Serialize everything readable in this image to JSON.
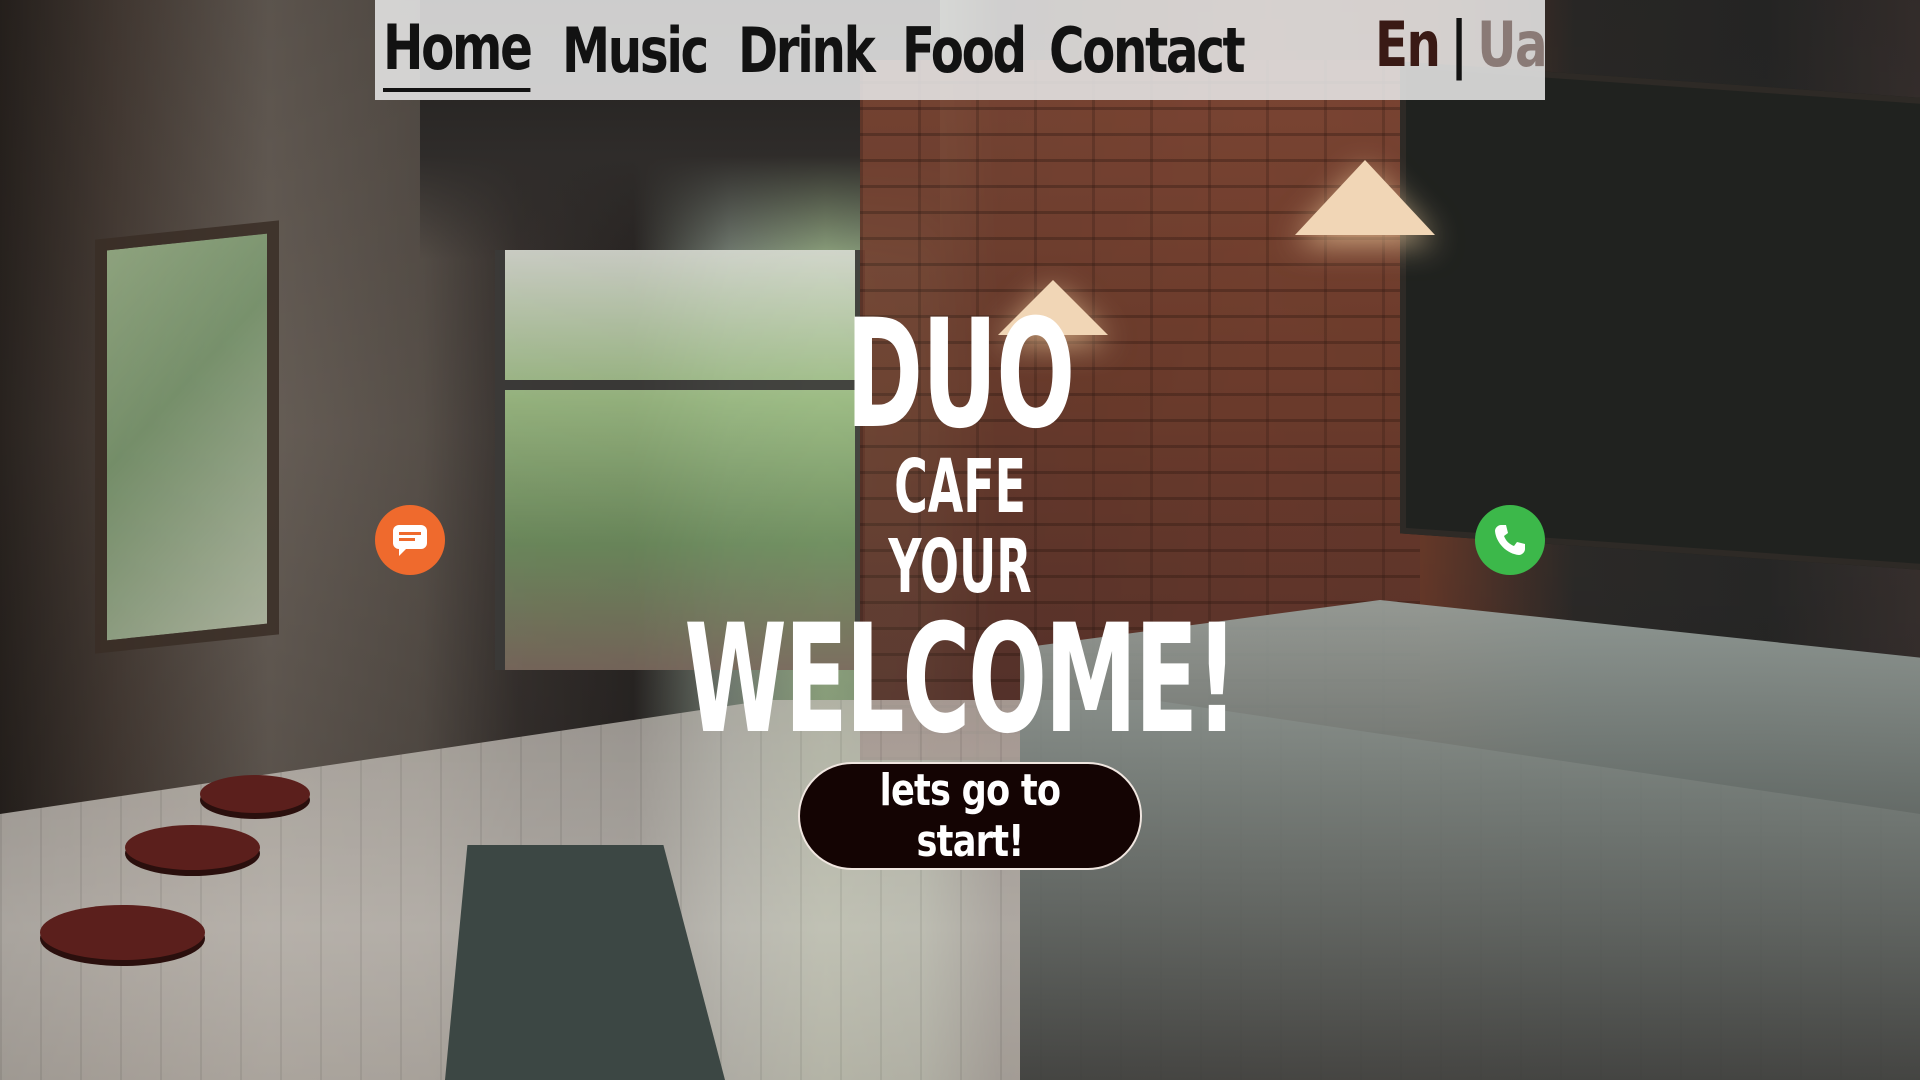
{
  "nav": {
    "items": [
      {
        "label": "Home",
        "active": true
      },
      {
        "label": "Music",
        "active": false
      },
      {
        "label": "Drink",
        "active": false
      },
      {
        "label": "Food",
        "active": false
      },
      {
        "label": "Contact",
        "active": false
      }
    ],
    "lang": {
      "en": "En",
      "separator": "|",
      "ua": "Ua",
      "selected": "En"
    }
  },
  "hero": {
    "line1": "DUO",
    "line2": "CAFE",
    "line3": "YOUR",
    "line4": "WELCOME!",
    "cta_label": "lets go to start!"
  },
  "icons": {
    "chat": "chat-bubble-icon",
    "phone": "phone-icon"
  },
  "colors": {
    "nav_bg": "#e6e6e6",
    "nav_text": "#121212",
    "lang_active": "#3a1a15",
    "lang_inactive": "#8a7a76",
    "chat_button": "#ef6a2d",
    "phone_button": "#3cb84a",
    "cta_bg": "#140403",
    "hero_text": "#ffffff"
  }
}
